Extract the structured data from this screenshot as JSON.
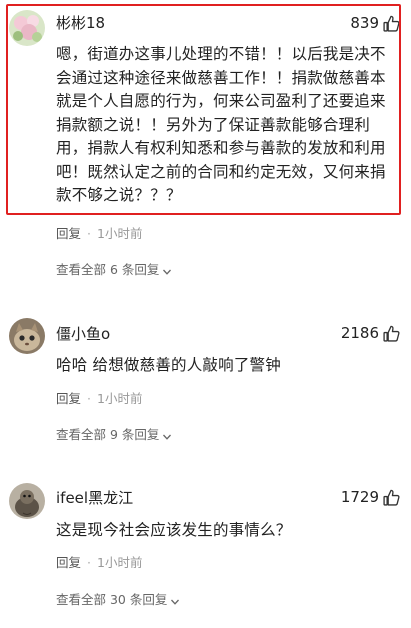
{
  "comments": [
    {
      "username": "彬彬18",
      "likes": "839",
      "body": "嗯，街道办这事儿处理的不错！！以后我是决不会通过这种途径来做慈善工作！！捐款做慈善本就是个人自愿的行为，何来公司盈利了还要追来捐款额之说！！另外为了保证善款能够合理利用，捐款人有权利知悉和参与善款的发放和利用吧！既然认定之前的合同和约定无效，又何来捐款不够之说？？？",
      "reply_label": "回复",
      "time": "1小时前",
      "view_replies": "查看全部 6 条回复"
    },
    {
      "username": "僵小鱼o",
      "likes": "2186",
      "body": "哈哈 给想做慈善的人敲响了警钟",
      "reply_label": "回复",
      "time": "1小时前",
      "view_replies": "查看全部 9 条回复"
    },
    {
      "username": "ifeel黑龙江",
      "likes": "1729",
      "body": "这是现今社会应该发生的事情么？",
      "reply_label": "回复",
      "time": "1小时前",
      "view_replies": "查看全部 30 条回复"
    }
  ],
  "icons": {
    "like": "thumbs-up-icon",
    "expand": "chevron-down-icon"
  },
  "colors": {
    "highlight_border": "#e02020",
    "meta_text": "#999999",
    "primary_text": "#222222"
  }
}
